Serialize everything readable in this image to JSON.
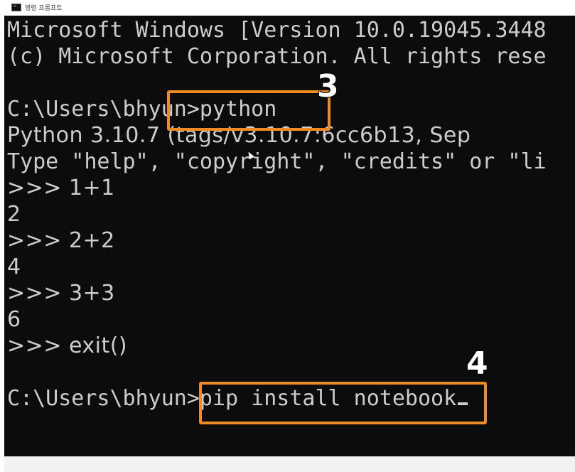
{
  "window": {
    "title": "명령 프롬프트"
  },
  "console": {
    "lines": [
      "Microsoft Windows [Version 10.0.19045.3448",
      "(c) Microsoft Corporation. All rights rese",
      "",
      "C:\\Users\\bhyun>python",
      "Python 3.10.7 (tags/v3.10.7:6cc6b13, Sep",
      "Type \"help\", \"copyright\", \"credits\" or \"li",
      ">>> 1+1",
      "2",
      ">>> 2+2",
      "4",
      ">>> 3+3",
      "6",
      ">>> exit()",
      "",
      "C:\\Users\\bhyun>pip install notebook"
    ]
  },
  "annotations": {
    "step3_label": "3",
    "step4_label": "4",
    "color": "#f08a24"
  },
  "colors": {
    "console_bg": "#0c0c0c",
    "console_text": "#cccccc"
  }
}
